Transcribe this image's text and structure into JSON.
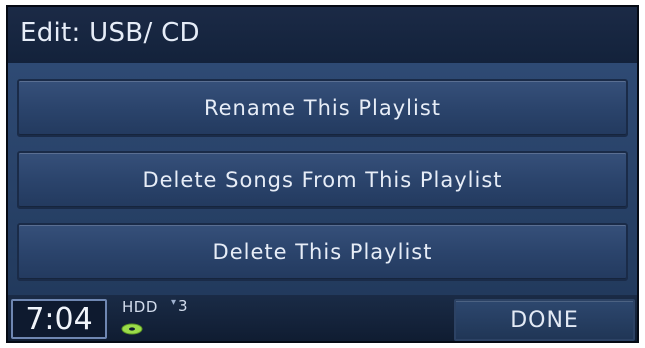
{
  "header": {
    "title": "Edit: USB/ CD"
  },
  "menu": {
    "items": [
      {
        "label": "Rename This Playlist"
      },
      {
        "label": "Delete Songs From This Playlist"
      },
      {
        "label": "Delete This Playlist"
      }
    ]
  },
  "status": {
    "time": "7:04",
    "source": "HDD",
    "track_number": "3",
    "disc_icon": "disc-icon",
    "done_label": "DONE"
  },
  "colors": {
    "background": "#0b1424",
    "button": "#2b446c",
    "text": "#e7edf7",
    "disc_accent": "#9bdc4a"
  }
}
